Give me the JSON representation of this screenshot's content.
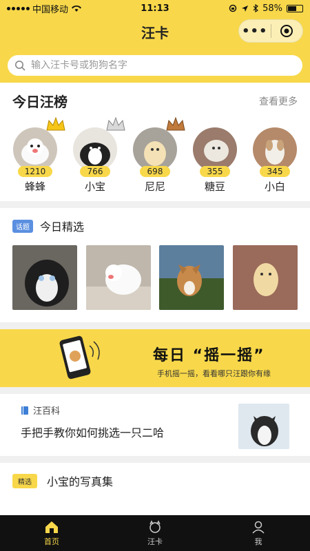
{
  "status": {
    "carrier": "中国移动",
    "time": "11:13",
    "battery": "58%"
  },
  "nav": {
    "title": "汪卡",
    "more_icon": "more-dots-icon",
    "close_icon": "target-icon"
  },
  "search": {
    "placeholder": "输入汪卡号或狗狗名字"
  },
  "ranking": {
    "title": "今日汪榜",
    "more": "查看更多",
    "items": [
      {
        "score": "1210",
        "name": "蜂蜂"
      },
      {
        "score": "766",
        "name": "小宝"
      },
      {
        "score": "698",
        "name": "尼尼"
      },
      {
        "score": "355",
        "name": "糖豆"
      },
      {
        "score": "345",
        "name": "小白"
      }
    ]
  },
  "picks": {
    "tag": "话题",
    "title": "今日精选"
  },
  "banner": {
    "title": "每日 “摇一摇”",
    "subtitle": "手机摇一摇，看看哪只汪跟你有缘"
  },
  "article": {
    "source": "汪百科",
    "title": "手把手教你如何挑选一只二哈"
  },
  "album": {
    "tag": "精选",
    "title": "小宝的写真集"
  },
  "tabs": [
    {
      "label": "首页",
      "icon": "home-icon"
    },
    {
      "label": "汪卡",
      "icon": "dog-card-icon"
    },
    {
      "label": "我",
      "icon": "user-icon"
    }
  ],
  "colors": {
    "accent": "#f8d84a",
    "tag_blue": "#5b8fe0",
    "tabbar": "#111111"
  }
}
